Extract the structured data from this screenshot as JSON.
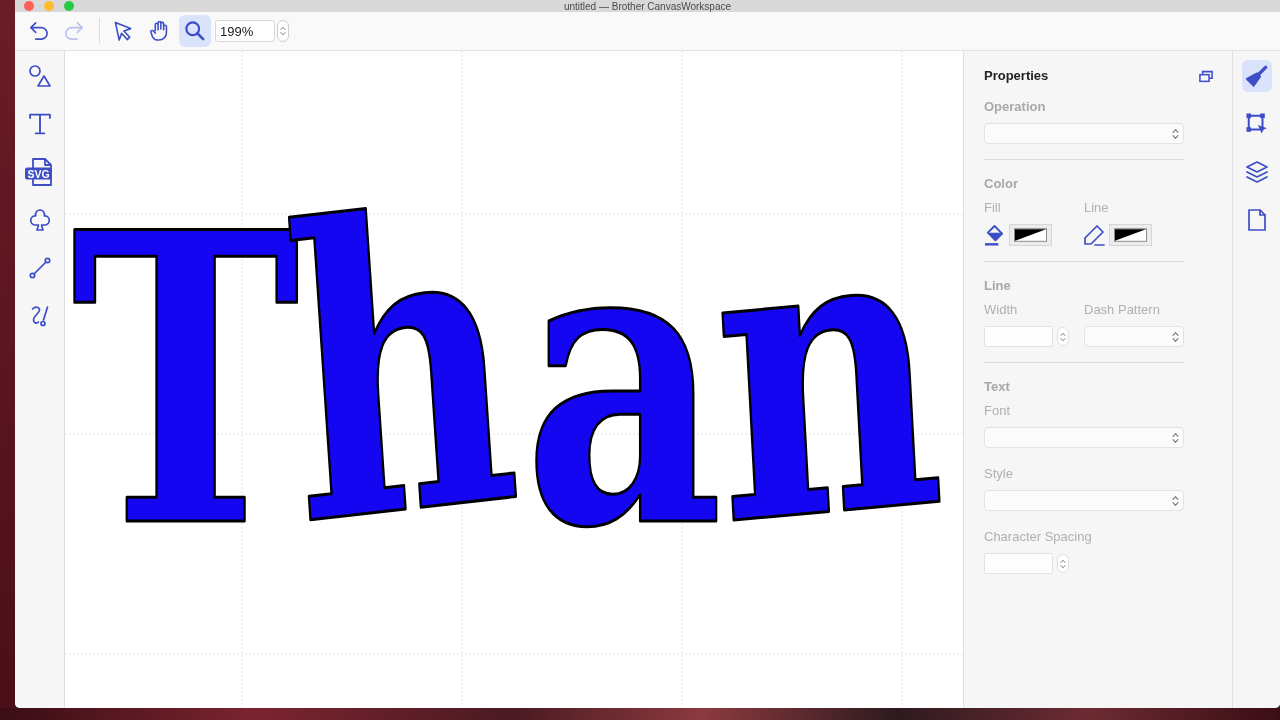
{
  "window": {
    "title": "untitled — Brother CanvasWorkspace"
  },
  "toolbar": {
    "history": [
      {
        "kind": "undo",
        "disabled": false
      },
      {
        "kind": "redo",
        "disabled": true
      }
    ],
    "tools": [
      {
        "kind": "select",
        "selected": false
      },
      {
        "kind": "hand",
        "selected": false
      },
      {
        "kind": "zoom",
        "selected": true
      }
    ],
    "zoom_field": {
      "value": "199%"
    }
  },
  "left_tools": [
    {
      "kind": "shapes"
    },
    {
      "kind": "text"
    },
    {
      "kind": "svg",
      "icon_text": "SVG"
    },
    {
      "kind": "pattern"
    },
    {
      "kind": "line"
    },
    {
      "kind": "freehand"
    }
  ],
  "canvas": {
    "text": "Than"
  },
  "properties": {
    "title": "Properties",
    "disabled": true,
    "sections": [
      {
        "heading": "Operation",
        "rows": [
          [
            {
              "kind": "select"
            }
          ]
        ]
      },
      {
        "heading": "Color",
        "rows": [
          [
            {
              "kind": "fill_color",
              "label": "Fill"
            },
            {
              "kind": "line_color",
              "label": "Line"
            }
          ]
        ]
      },
      {
        "heading": "Line",
        "rows": [
          [
            {
              "kind": "number",
              "label": "Width"
            },
            {
              "kind": "select",
              "label": "Dash Pattern"
            }
          ]
        ]
      },
      {
        "heading": "Text",
        "rows": [
          [
            {
              "kind": "select",
              "label": "Font"
            }
          ],
          [
            {
              "kind": "select",
              "label": "Style"
            }
          ],
          [
            {
              "kind": "number",
              "label": "Character Spacing"
            }
          ]
        ]
      }
    ]
  },
  "side_tabs": [
    {
      "kind": "properties",
      "selected": true
    },
    {
      "kind": "transform",
      "selected": false
    },
    {
      "kind": "layers",
      "selected": false
    },
    {
      "kind": "page",
      "selected": false
    }
  ]
}
